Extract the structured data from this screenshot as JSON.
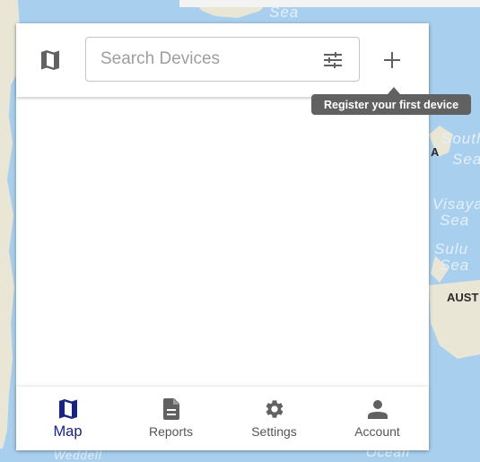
{
  "map": {
    "labels": {
      "sea_top": "Sea",
      "sea_south_china_1": "South",
      "sea_south_china_2": "Sea",
      "sea_visayan_1": "Visaya",
      "sea_visayan_2": "Sea",
      "sea_sulu_1": "Sulu",
      "sea_sulu_2": "Sea",
      "land_china": "A",
      "land_australia": "AUST",
      "sea_bottom_left": "Weddell",
      "sea_bottom_right": "Ocean"
    }
  },
  "toolbar": {
    "search_placeholder": "Search Devices",
    "search_value": ""
  },
  "icons": {
    "map_toggle": "map-icon",
    "filter": "tune-icon",
    "add": "plus-icon"
  },
  "tooltip": {
    "text": "Register your first device"
  },
  "nav": {
    "items": [
      {
        "label": "Map",
        "icon": "map-icon",
        "active": true
      },
      {
        "label": "Reports",
        "icon": "document-icon",
        "active": false
      },
      {
        "label": "Settings",
        "icon": "gear-icon",
        "active": false
      },
      {
        "label": "Account",
        "icon": "person-icon",
        "active": false
      }
    ]
  },
  "colors": {
    "accent": "#1a237e",
    "icon_gray": "#616161",
    "tooltip_bg": "#616161",
    "ocean": "#a9cfee",
    "land": "#e9e6d6"
  }
}
